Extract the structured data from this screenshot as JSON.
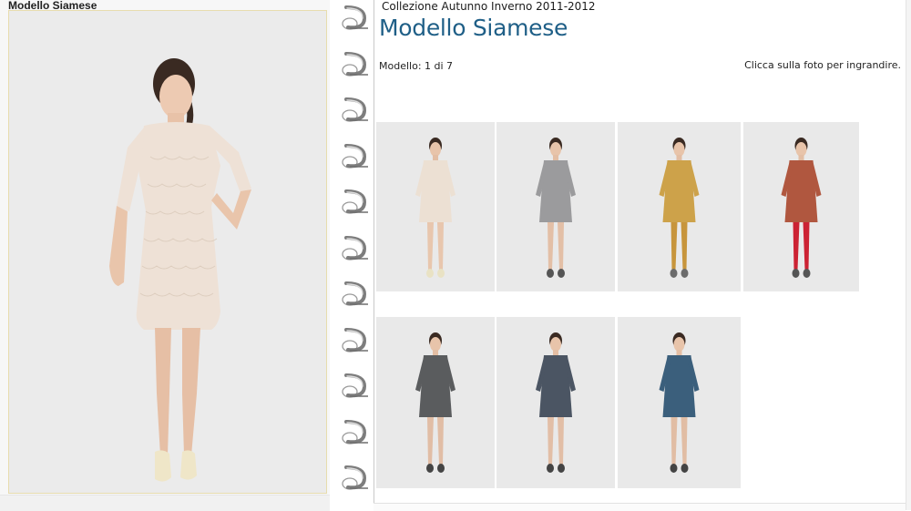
{
  "left_panel": {
    "title": "Modello Siamese"
  },
  "header": {
    "collection": "Collezione Autunno Inverno 2011-2012",
    "title": "Modello Siamese",
    "counter": "Modello: 1 di 7",
    "hint": "Clicca sulla foto per ingrandire."
  },
  "main_photo": {
    "dress_color": "#eee1d6",
    "shoe_color": "#efe6c8"
  },
  "thumbnails": [
    {
      "name": "thumb-model-1",
      "dress_color": "#ece0d3",
      "leg_color": "#e8c6ad",
      "shoe_color": "#e9e2c4"
    },
    {
      "name": "thumb-model-2",
      "dress_color": "#9b9b9d",
      "leg_color": "#e3bfa6",
      "shoe_color": "#555555"
    },
    {
      "name": "thumb-model-3",
      "dress_color": "#cda24a",
      "leg_color": "#c7953c",
      "shoe_color": "#6b6b6b"
    },
    {
      "name": "thumb-model-4",
      "dress_color": "#b0573f",
      "leg_color": "#cc2233",
      "shoe_color": "#555555"
    },
    {
      "name": "thumb-model-5",
      "dress_color": "#5a5c5e",
      "leg_color": "#e1bda5",
      "shoe_color": "#444444"
    },
    {
      "name": "thumb-model-6",
      "dress_color": "#4b5563",
      "leg_color": "#e2bea6",
      "shoe_color": "#444444"
    },
    {
      "name": "thumb-model-7",
      "dress_color": "#3b5f7c",
      "leg_color": "#e1bda4",
      "shoe_color": "#444444"
    }
  ]
}
